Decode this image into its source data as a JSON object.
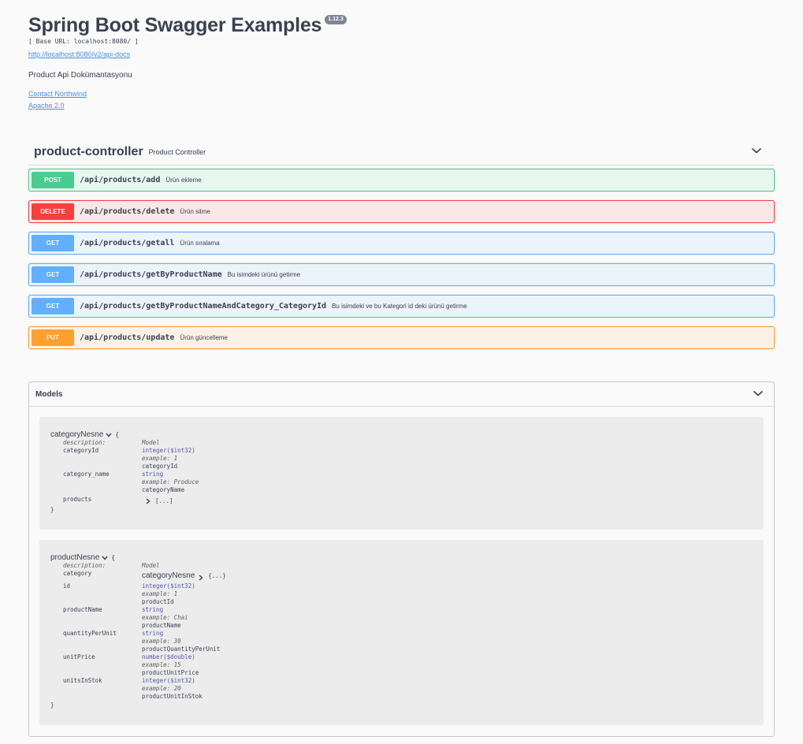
{
  "info": {
    "title": "Spring Boot Swagger Examples",
    "version": "1.12.3",
    "base_url": "[ Base URL: localhost:8080/ ]",
    "api_docs_link": "http://localhost:8080/v2/api-docs",
    "description": "Product Api Dokümantasyonu",
    "contact_link": "Contact Northwind",
    "license_link": "Apache 2.0"
  },
  "tag": {
    "name": "product-controller",
    "description": "Product Controller"
  },
  "operations": [
    {
      "method": "POST",
      "path": "/api/products/add",
      "summary": "Ürün ekleme"
    },
    {
      "method": "DELETE",
      "path": "/api/products/delete",
      "summary": "Ürün silme"
    },
    {
      "method": "GET",
      "path": "/api/products/getall",
      "summary": "Ürün sıralama"
    },
    {
      "method": "GET",
      "path": "/api/products/getByProductName",
      "summary": "Bu isimdeki ürünü getirme"
    },
    {
      "method": "GET",
      "path": "/api/products/getByProductNameAndCategory_CategoryId",
      "summary": "Bu isimdeki ve bu Kategori id deki ürünü getirme"
    },
    {
      "method": "PUT",
      "path": "/api/products/update",
      "summary": "Ürün güncelleme"
    }
  ],
  "models": {
    "title": "Models",
    "category": {
      "name": "categoryNesne",
      "open_brace": "{",
      "close_brace": "}",
      "description_label": "description:",
      "description_value": "Model",
      "props": {
        "categoryId": {
          "name": "categoryId",
          "type": "integer($int32)",
          "example": "example: 1",
          "title": "categoryId"
        },
        "category_name": {
          "name": "category_name",
          "type": "string",
          "example": "example: Produce",
          "title": "categoryName"
        },
        "products": {
          "name": "products",
          "value": "[...]"
        }
      }
    },
    "product": {
      "name": "productNesne",
      "open_brace": "{",
      "close_brace": "}",
      "description_label": "description:",
      "description_value": "Model",
      "props": {
        "category": {
          "name": "category",
          "ref": "categoryNesne",
          "value": "{...}"
        },
        "id": {
          "name": "id",
          "type": "integer($int32)",
          "example": "example: 1",
          "title": "productId"
        },
        "productName": {
          "name": "productName",
          "type": "string",
          "example": "example: Chai",
          "title": "productName"
        },
        "quantityPerUnit": {
          "name": "quantityPerUnit",
          "type": "string",
          "example": "example: 30",
          "title": "productQuantityPerUnit"
        },
        "unitPrice": {
          "name": "unitPrice",
          "type": "number($double)",
          "example": "example: 15",
          "title": "productUnitPrice"
        },
        "unitsInStok": {
          "name": "unitsInStok",
          "type": "integer($int32)",
          "example": "example: 20",
          "title": "productUnitInStok"
        }
      }
    }
  }
}
